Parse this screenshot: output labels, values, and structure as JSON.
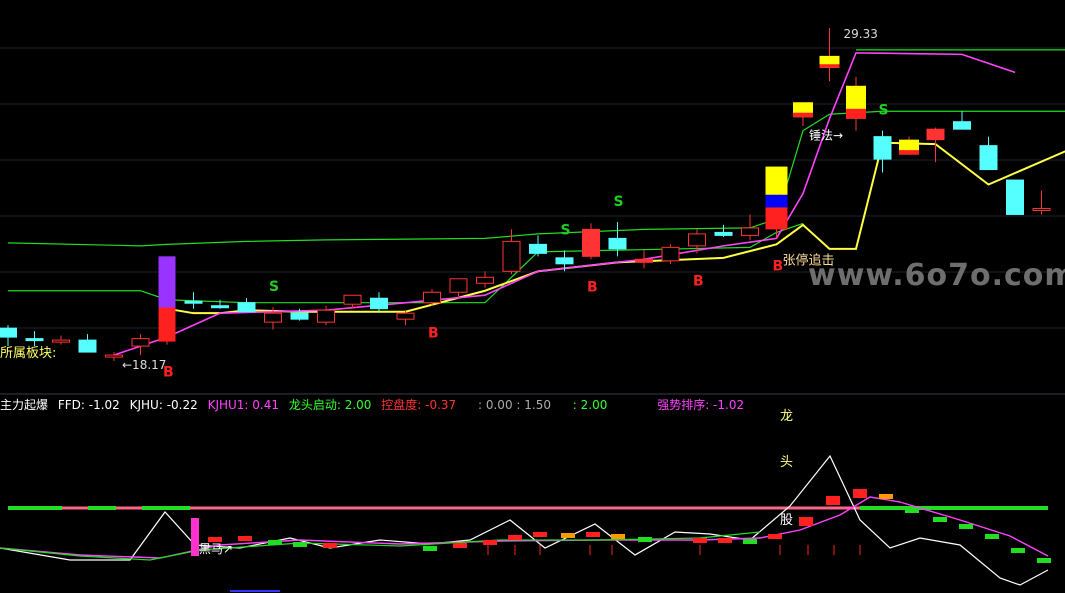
{
  "main_panel": {
    "sector_label": "所属板块:",
    "high_label": "29.33",
    "low_label": "18.17",
    "low_arrow": "←",
    "zhangting_label": "张停追击",
    "chuifa_label": "锤法",
    "watermark": "www.6o7o.com",
    "markers": [
      {
        "text": "B",
        "color": "#ff2020",
        "x_index": 6
      },
      {
        "text": "B",
        "color": "#ff2020",
        "x_index": 16
      },
      {
        "text": "B",
        "color": "#ff2020",
        "x_index": 22
      },
      {
        "text": "B",
        "color": "#ff2020",
        "x_index": 26
      },
      {
        "text": "B",
        "color": "#ff2020",
        "x_index": 29
      },
      {
        "text": "S",
        "color": "#22cc22",
        "x_index": 10
      },
      {
        "text": "S",
        "color": "#22cc22",
        "x_index": 21
      },
      {
        "text": "S",
        "color": "#22cc22",
        "x_index": 23
      },
      {
        "text": "S",
        "color": "#22cc22",
        "x_index": 33
      }
    ]
  },
  "indicator_bar": {
    "name": "主力起爆",
    "ffd": "FFD: -1.02",
    "kjhu": "KJHU: -0.22",
    "kjhu1": "KJHU1: 0.41",
    "longtou": "龙头启动: 2.00",
    "kongpan": "控盘度: -0.37",
    "extra1": ": 0.00 : 1.50",
    "extra2": ": 2.00",
    "qiangshi": "强势排序: -1.02",
    "colors": {
      "name": "#ffffff",
      "ffd": "#ffffff",
      "kjhu": "#ffffff",
      "kjhu1": "#ff44ff",
      "longtou": "#33ff33",
      "kongpan": "#ff3333",
      "extra1": "#aaaaaa",
      "extra2": "#33ff33",
      "qiangshi": "#ff44ff"
    }
  },
  "sub_panel": {
    "heima_label": "黑马",
    "heima_arrow": "↗",
    "longtou_chars": [
      "龙",
      "头",
      "股"
    ]
  },
  "chart_data": {
    "type": "candlestick",
    "price_range": [
      17.5,
      30.0
    ],
    "candles": [
      {
        "o": 19.0,
        "h": 19.4,
        "l": 18.7,
        "c": 19.3,
        "up": false
      },
      {
        "o": 18.95,
        "h": 19.2,
        "l": 18.7,
        "c": 18.95,
        "up": false
      },
      {
        "o": 18.9,
        "h": 19.05,
        "l": 18.75,
        "c": 18.85,
        "up": true
      },
      {
        "o": 18.9,
        "h": 19.1,
        "l": 18.5,
        "c": 18.5,
        "up": false
      },
      {
        "o": 18.35,
        "h": 18.5,
        "l": 18.2,
        "c": 18.4,
        "up": true
      },
      {
        "o": 18.7,
        "h": 19.1,
        "l": 18.4,
        "c": 18.95,
        "up": true
      },
      {
        "o": 18.85,
        "h": 21.7,
        "l": 18.75,
        "c": 21.7,
        "up": true,
        "special": "purple"
      },
      {
        "o": 20.2,
        "h": 20.5,
        "l": 19.95,
        "c": 20.2,
        "up": false
      },
      {
        "o": 20.05,
        "h": 20.25,
        "l": 19.95,
        "c": 20.0,
        "up": false
      },
      {
        "o": 19.85,
        "h": 20.3,
        "l": 19.85,
        "c": 20.15,
        "up": false
      },
      {
        "o": 19.5,
        "h": 20.0,
        "l": 19.25,
        "c": 19.8,
        "up": true
      },
      {
        "o": 19.8,
        "h": 19.95,
        "l": 19.55,
        "c": 19.6,
        "up": false
      },
      {
        "o": 19.5,
        "h": 20.05,
        "l": 19.4,
        "c": 19.9,
        "up": true
      },
      {
        "o": 20.1,
        "h": 20.4,
        "l": 19.95,
        "c": 20.4,
        "up": true
      },
      {
        "o": 20.3,
        "h": 20.5,
        "l": 19.85,
        "c": 19.95,
        "up": false
      },
      {
        "o": 19.6,
        "h": 19.9,
        "l": 19.4,
        "c": 19.8,
        "up": true
      },
      {
        "o": 20.15,
        "h": 20.6,
        "l": 20.05,
        "c": 20.5,
        "up": true
      },
      {
        "o": 20.5,
        "h": 20.9,
        "l": 20.3,
        "c": 20.95,
        "up": true
      },
      {
        "o": 20.8,
        "h": 21.2,
        "l": 20.65,
        "c": 21.0,
        "up": true
      },
      {
        "o": 21.2,
        "h": 22.6,
        "l": 21.1,
        "c": 22.2,
        "up": true
      },
      {
        "o": 22.1,
        "h": 22.4,
        "l": 21.7,
        "c": 21.8,
        "up": false
      },
      {
        "o": 21.45,
        "h": 21.9,
        "l": 21.2,
        "c": 21.65,
        "up": false
      },
      {
        "o": 21.7,
        "h": 22.8,
        "l": 21.6,
        "c": 22.6,
        "up": true,
        "filled": true
      },
      {
        "o": 22.3,
        "h": 22.85,
        "l": 21.7,
        "c": 21.95,
        "up": false
      },
      {
        "o": 21.5,
        "h": 21.9,
        "l": 21.3,
        "c": 21.6,
        "up": true,
        "filled": true
      },
      {
        "o": 21.55,
        "h": 22.1,
        "l": 21.45,
        "c": 22.0,
        "up": true
      },
      {
        "o": 22.05,
        "h": 22.6,
        "l": 21.8,
        "c": 22.45,
        "up": true
      },
      {
        "o": 22.5,
        "h": 22.75,
        "l": 22.35,
        "c": 22.4,
        "up": false
      },
      {
        "o": 22.4,
        "h": 23.1,
        "l": 22.25,
        "c": 22.65,
        "up": true
      },
      {
        "o": 22.6,
        "h": 24.7,
        "l": 22.3,
        "c": 24.7,
        "up": true,
        "special": "limit"
      },
      {
        "o": 26.35,
        "h": 26.85,
        "l": 26.05,
        "c": 26.85,
        "up": true,
        "special": "yellow"
      },
      {
        "o": 28.0,
        "h": 29.33,
        "l": 27.55,
        "c": 28.4,
        "up": true,
        "special": "yellow"
      },
      {
        "o": 27.4,
        "h": 27.7,
        "l": 25.9,
        "c": 26.3,
        "up": true,
        "special": "yellow"
      },
      {
        "o": 25.7,
        "h": 25.9,
        "l": 24.5,
        "c": 24.95,
        "up": false
      },
      {
        "o": 25.1,
        "h": 25.7,
        "l": 25.1,
        "c": 25.6,
        "up": true,
        "special": "yellow"
      },
      {
        "o": 25.95,
        "h": 26.0,
        "l": 24.85,
        "c": 25.6,
        "up": true,
        "filled": true
      },
      {
        "o": 25.95,
        "h": 26.55,
        "l": 25.95,
        "c": 26.2,
        "up": false
      },
      {
        "o": 25.4,
        "h": 25.7,
        "l": 24.6,
        "c": 24.6,
        "up": false
      },
      {
        "o": 24.25,
        "h": 24.25,
        "l": 23.1,
        "c": 23.1,
        "up": false
      },
      {
        "o": 23.3,
        "h": 23.9,
        "l": 23.1,
        "c": 23.25,
        "up": true
      }
    ],
    "horizontal_levels": [
      {
        "name": "upper",
        "color": "#22dd22",
        "points": [
          [
            0,
            22.15
          ],
          [
            5,
            22.05
          ],
          [
            6,
            22.1
          ],
          [
            9,
            22.2
          ],
          [
            12,
            22.25
          ],
          [
            18,
            22.3
          ],
          [
            20,
            22.45
          ],
          [
            24,
            22.6
          ],
          [
            28,
            22.65
          ],
          [
            29,
            22.95
          ],
          [
            30,
            25.9
          ],
          [
            31,
            26.45
          ],
          [
            33,
            26.55
          ],
          [
            40,
            26.55
          ]
        ]
      },
      {
        "name": "lower",
        "color": "#22dd22",
        "points": [
          [
            0,
            20.55
          ],
          [
            5,
            20.55
          ],
          [
            6,
            20.25
          ],
          [
            9,
            20.15
          ],
          [
            18,
            20.15
          ],
          [
            20,
            21.85
          ],
          [
            28,
            22.0
          ],
          [
            29,
            22.5
          ],
          [
            30,
            22.8
          ]
        ]
      },
      {
        "name": "top",
        "color": "#22dd22",
        "points": [
          [
            32,
            28.6
          ],
          [
            36,
            28.6
          ],
          [
            40,
            28.6
          ]
        ]
      }
    ],
    "ma_lines": [
      {
        "name": "ma_yellow",
        "color": "#ffff44",
        "points": [
          [
            6,
            19.95
          ],
          [
            7,
            19.8
          ],
          [
            8,
            19.8
          ],
          [
            9,
            19.9
          ],
          [
            11,
            19.85
          ],
          [
            15,
            19.85
          ],
          [
            18,
            20.55
          ],
          [
            20,
            21.2
          ],
          [
            23,
            21.5
          ],
          [
            27,
            21.65
          ],
          [
            29,
            22.1
          ],
          [
            30,
            22.75
          ],
          [
            31,
            21.95
          ],
          [
            32,
            21.95
          ],
          [
            33,
            25.5
          ],
          [
            35,
            25.45
          ],
          [
            37,
            24.1
          ],
          [
            40,
            25.25
          ]
        ]
      },
      {
        "name": "ma_white",
        "color": "#ffffff",
        "points": [
          [
            4,
            18.4
          ],
          [
            6,
            19.0
          ],
          [
            8,
            19.8
          ],
          [
            12,
            19.9
          ],
          [
            18,
            20.4
          ],
          [
            20,
            21.2
          ],
          [
            24,
            21.6
          ],
          [
            27,
            22.05
          ],
          [
            29,
            22.3
          ],
          [
            30,
            23.8
          ],
          [
            31,
            26.3
          ],
          [
            32,
            28.5
          ],
          [
            36,
            28.45
          ],
          [
            38,
            27.85
          ]
        ]
      }
    ]
  }
}
